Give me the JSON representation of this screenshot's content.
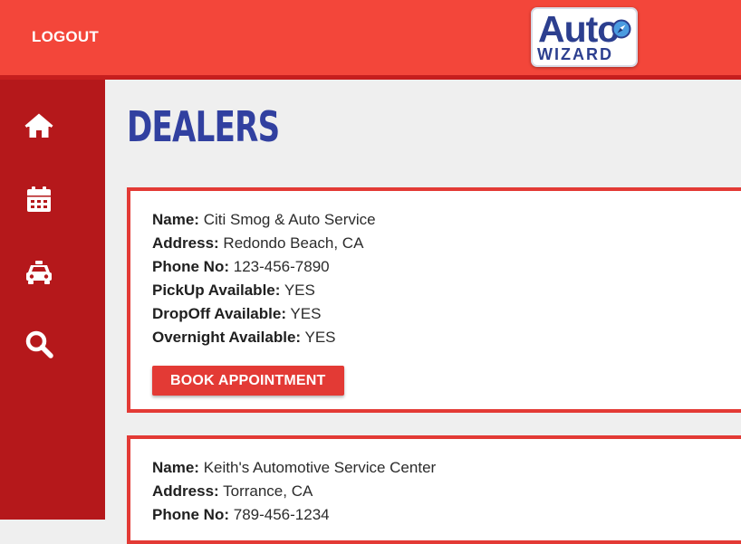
{
  "header": {
    "logout_label": "LOGOUT",
    "logo_word_top": "Auto",
    "logo_word_bottom": "WIZARD"
  },
  "sidebar": {
    "items": [
      {
        "icon": "home-icon"
      },
      {
        "icon": "calendar-icon"
      },
      {
        "icon": "car-icon"
      },
      {
        "icon": "search-icon"
      }
    ]
  },
  "page": {
    "title": "DEALERS"
  },
  "labels": {
    "name": "Name:",
    "address": "Address:",
    "phone": "Phone No:",
    "pickup": "PickUp Available:",
    "dropoff": "DropOff Available:",
    "overnight": "Overnight Available:",
    "book_button": "BOOK APPOINTMENT"
  },
  "dealers": [
    {
      "name": "Citi Smog & Auto Service",
      "address": "Redondo Beach, CA",
      "phone": "123-456-7890",
      "pickup": "YES",
      "dropoff": "YES",
      "overnight": "YES"
    },
    {
      "name": "Keith's Automotive Service Center",
      "address": "Torrance, CA",
      "phone": "789-456-1234"
    }
  ],
  "colors": {
    "header_bg": "#f3463a",
    "sidebar_bg": "#b5181b",
    "accent": "#e33a35",
    "title": "#3140a0",
    "logo_blue": "#2c3f8f"
  }
}
